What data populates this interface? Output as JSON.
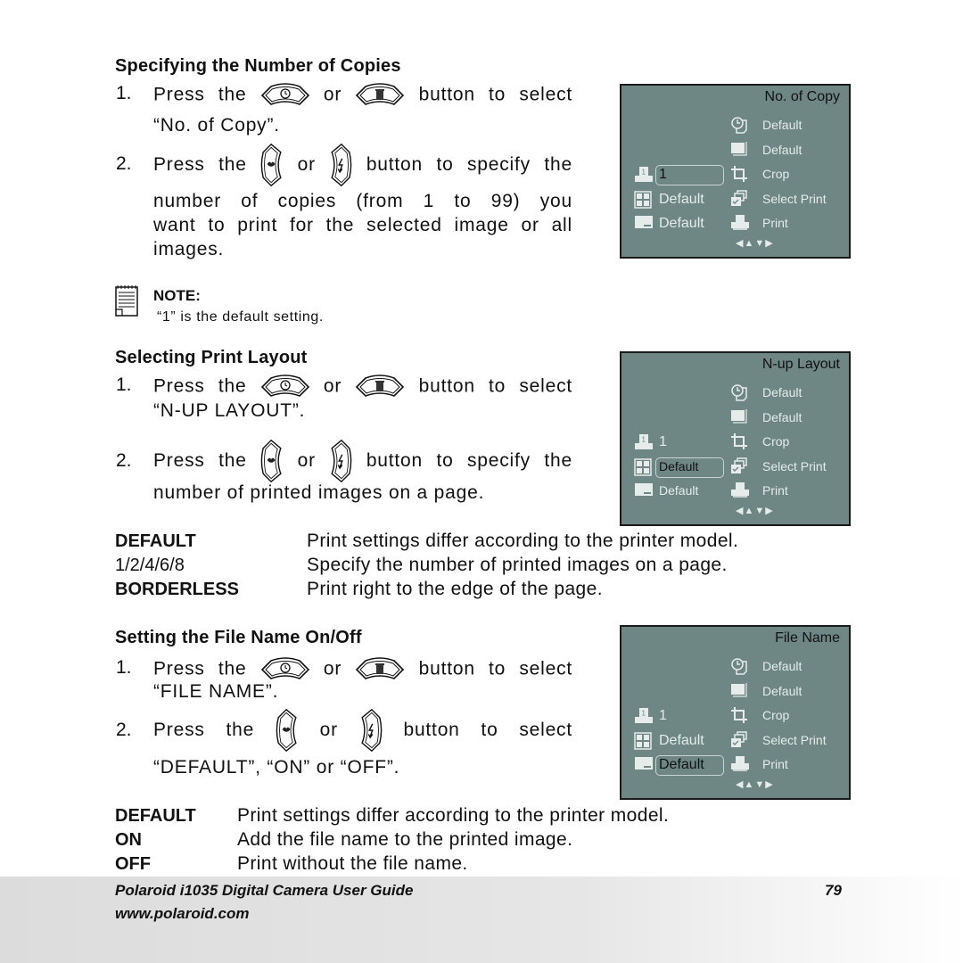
{
  "section1": {
    "heading": "Specifying the Number of Copies",
    "step1_num": "1.",
    "step1_a": "Press the",
    "step1_or": "or",
    "step1_b": "button to select",
    "step1_c": "“No. of Copy”.",
    "step2_num": "2.",
    "step2_a": "Press the",
    "step2_or": "or",
    "step2_b": "button to specify the",
    "step2_c": "number of copies (from 1 to 99) you",
    "step2_d": "want to print for the selected image or all",
    "step2_e": "images.",
    "note_label": "NOTE:",
    "note_text": "“1” is the default setting."
  },
  "section2": {
    "heading": "Selecting Print Layout",
    "step1_num": "1.",
    "step1_a": "Press the",
    "step1_or": "or",
    "step1_b": "button to select",
    "step1_c": "“N-UP LAYOUT”.",
    "step2_num": "2.",
    "step2_a": "Press the",
    "step2_or": "or",
    "step2_b": "button to specify the",
    "step2_c": "number of printed images on a page.",
    "definitions": [
      {
        "key": "DEFAULT",
        "value": "Print settings differ according to the printer model."
      },
      {
        "key": "1/2/4/6/8",
        "value": "Specify the number of printed images on a page."
      },
      {
        "key": "BORDERLESS",
        "value": "Print right to the edge of the page."
      }
    ]
  },
  "section3": {
    "heading": "Setting the File Name On/Off",
    "step1_num": "1.",
    "step1_a": "Press the",
    "step1_or": "or",
    "step1_b": "button to select",
    "step1_c": "“FILE NAME”.",
    "step2_num": "2.",
    "step2_a": "Press the",
    "step2_or": "or",
    "step2_b": "button to select",
    "step2_c": "“DEFAULT”, “ON” or “OFF”.",
    "definitions": [
      {
        "key": "DEFAULT",
        "value": "Print settings differ according to the printer model."
      },
      {
        "key": "ON",
        "value": "Add the file name to the printed image."
      },
      {
        "key": "OFF",
        "value": "Print without the file name."
      }
    ]
  },
  "screens": [
    {
      "title": "No. of Copy",
      "left": {
        "copies": "1",
        "layout": "Default",
        "filename": "Default"
      },
      "right": [
        "Default",
        "Default",
        "Crop",
        "Select Print",
        "Print"
      ],
      "selected": "copies"
    },
    {
      "title": "N-up Layout",
      "left": {
        "copies": "1",
        "layout": "Default",
        "filename": "Default"
      },
      "right": [
        "Default",
        "Default",
        "Crop",
        "Select Print",
        "Print"
      ],
      "selected": "layout"
    },
    {
      "title": "File Name",
      "left": {
        "copies": "1",
        "layout": "Default",
        "filename": "Default"
      },
      "right": [
        "Default",
        "Default",
        "Crop",
        "Select Print",
        "Print"
      ],
      "selected": "filename"
    }
  ],
  "screen_nav": "◀▲▼▶",
  "footer": {
    "title": "Polaroid i1035 Digital Camera User Guide",
    "url": "www.polaroid.com",
    "page": "79"
  },
  "colors": {
    "screen_bg": "#6e8784",
    "screen_text": "#e6ecea"
  }
}
